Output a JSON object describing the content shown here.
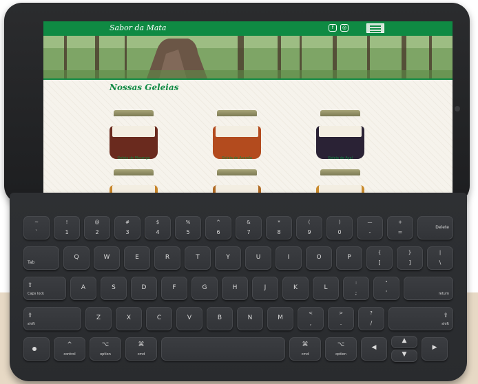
{
  "site": {
    "logo_text": "Sabor da Mata",
    "social": [
      {
        "icon": "facebook-icon",
        "glyph": "f"
      },
      {
        "icon": "instagram-icon",
        "glyph": "◎"
      }
    ],
    "section_title": "Nossas Geleias",
    "products": [
      {
        "caption": "Geleia de Morango",
        "color": "#6a2a1e"
      },
      {
        "caption": "Geleia de Acerola",
        "color": "#b34b1e"
      },
      {
        "caption": "Geleia de Açaí",
        "color": "#2a2235"
      },
      {
        "caption": "",
        "color": "#c7852a"
      },
      {
        "caption": "",
        "color": "#b06a24"
      },
      {
        "caption": "",
        "color": "#c98b2e"
      }
    ],
    "brand_color": "#0f8a43"
  },
  "keyboard": {
    "row1": [
      {
        "top": "~",
        "bot": "`"
      },
      {
        "top": "!",
        "bot": "1"
      },
      {
        "top": "@",
        "bot": "2"
      },
      {
        "top": "#",
        "bot": "3"
      },
      {
        "top": "$",
        "bot": "4"
      },
      {
        "top": "%",
        "bot": "5"
      },
      {
        "top": "^",
        "bot": "6"
      },
      {
        "top": "&",
        "bot": "7"
      },
      {
        "top": "*",
        "bot": "8"
      },
      {
        "top": "(",
        "bot": "9"
      },
      {
        "top": ")",
        "bot": "0"
      },
      {
        "top": "—",
        "bot": "-"
      },
      {
        "top": "+",
        "bot": "="
      }
    ],
    "delete_label": "Delete",
    "tab_label": "Tab",
    "row2": [
      "Q",
      "W",
      "E",
      "R",
      "T",
      "Y",
      "U",
      "I",
      "O",
      "P"
    ],
    "row2_sym": [
      {
        "top": "{",
        "bot": "["
      },
      {
        "top": "}",
        "bot": "]"
      },
      {
        "top": "|",
        "bot": "\\"
      }
    ],
    "caps_label": "Caps lock",
    "caps_icon": "⇪",
    "row3": [
      "A",
      "S",
      "D",
      "F",
      "G",
      "H",
      "J",
      "K",
      "L"
    ],
    "row3_sym": [
      {
        "top": ":",
        "bot": ";"
      },
      {
        "top": "\"",
        "bot": "'"
      }
    ],
    "return_label": "return",
    "shift_label": "shift",
    "shift_icon": "⇧",
    "row4": [
      "Z",
      "X",
      "C",
      "V",
      "B",
      "N",
      "M"
    ],
    "row4_sym": [
      {
        "top": "<",
        "bot": ","
      },
      {
        "top": ">",
        "bot": "."
      },
      {
        "top": "?",
        "bot": "/"
      }
    ],
    "control_label": "control",
    "control_icon": "^",
    "option_label": "option",
    "option_icon": "⌥",
    "cmd_label": "cmd",
    "cmd_icon": "⌘",
    "arrow_left": "◀",
    "arrow_up": "▲",
    "arrow_down": "▼",
    "arrow_right": "▶"
  }
}
